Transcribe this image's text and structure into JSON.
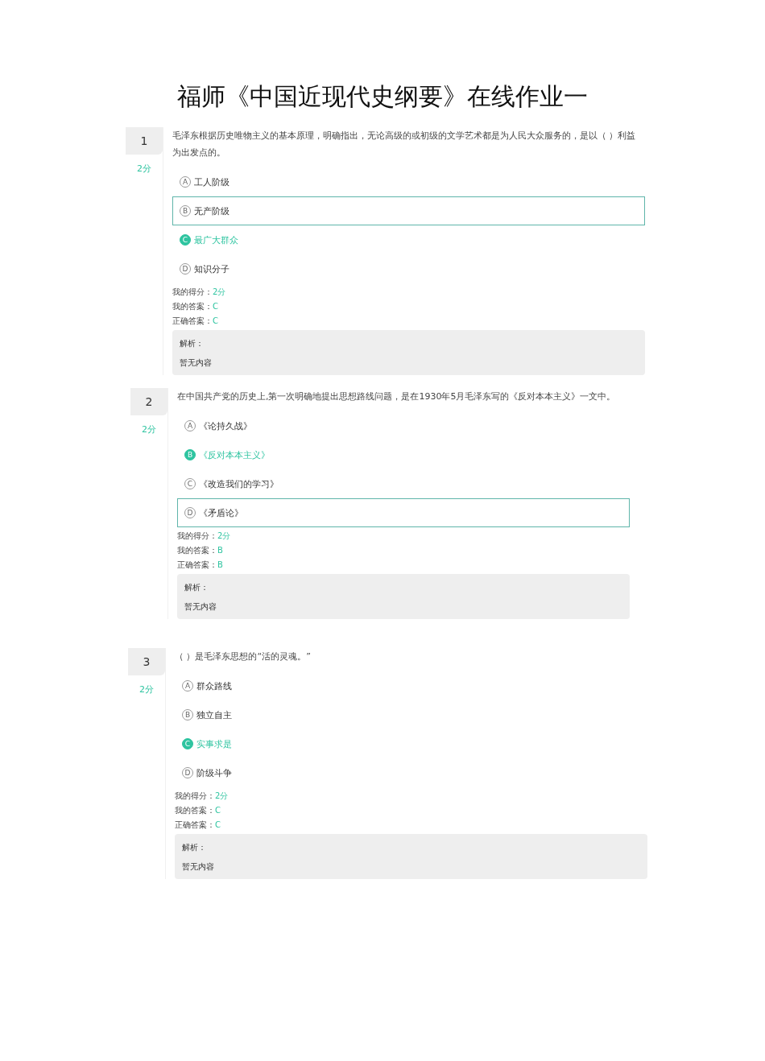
{
  "title": "福师《中国近现代史纲要》在线作业一",
  "questions": [
    {
      "number": "1",
      "score": "2分",
      "text": "毛泽东根据历史唯物主义的基本原理，明确指出，无论高级的或初级的文学艺术都是为人民大众服务的，是以（ ）利益为出发点的。",
      "options": [
        {
          "letter": "A",
          "text": "工人阶级",
          "selected": false,
          "hovered": false
        },
        {
          "letter": "B",
          "text": "无产阶级",
          "selected": false,
          "hovered": true
        },
        {
          "letter": "C",
          "text": "最广大群众",
          "selected": true,
          "hovered": false
        },
        {
          "letter": "D",
          "text": "知识分子",
          "selected": false,
          "hovered": false
        }
      ],
      "results": [
        {
          "label": "我的得分：",
          "value": "2分"
        },
        {
          "label": "我的答案：",
          "value": "C"
        },
        {
          "label": "正确答案：",
          "value": "C"
        }
      ],
      "analysis": {
        "label": "解析：",
        "text": "暂无内容"
      }
    },
    {
      "number": "2",
      "score": "2分",
      "text": "在中国共产党的历史上,第一次明确地提出思想路线问题，是在1930年5月毛泽东写的《反对本本主义》一文中。",
      "options": [
        {
          "letter": "A",
          "text": "《论持久战》",
          "selected": false,
          "hovered": false
        },
        {
          "letter": "B",
          "text": "《反对本本主义》",
          "selected": true,
          "hovered": false
        },
        {
          "letter": "C",
          "text": "《改造我们的学习》",
          "selected": false,
          "hovered": false
        },
        {
          "letter": "D",
          "text": "《矛盾论》",
          "selected": false,
          "hovered": true
        }
      ],
      "results": [
        {
          "label": "我的得分：",
          "value": "2分"
        },
        {
          "label": "我的答案：",
          "value": "B"
        },
        {
          "label": "正确答案：",
          "value": "B"
        }
      ],
      "analysis": {
        "label": "解析：",
        "text": "暂无内容"
      }
    },
    {
      "number": "3",
      "score": "2分",
      "text": "（ ）是毛泽东思想的“活的灵魂。”",
      "options": [
        {
          "letter": "A",
          "text": "群众路线",
          "selected": false,
          "hovered": false
        },
        {
          "letter": "B",
          "text": "独立自主",
          "selected": false,
          "hovered": false
        },
        {
          "letter": "C",
          "text": "实事求是",
          "selected": true,
          "hovered": false
        },
        {
          "letter": "D",
          "text": "阶级斗争",
          "selected": false,
          "hovered": false
        }
      ],
      "results": [
        {
          "label": "我的得分：",
          "value": "2分"
        },
        {
          "label": "我的答案：",
          "value": "C"
        },
        {
          "label": "正确答案：",
          "value": "C"
        }
      ],
      "analysis": {
        "label": "解析：",
        "text": "暂无内容"
      }
    }
  ]
}
